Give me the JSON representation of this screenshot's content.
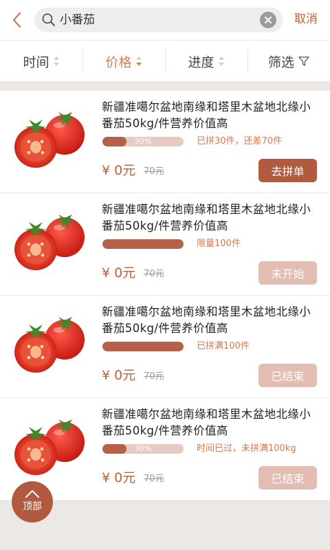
{
  "search": {
    "query": "小番茄",
    "cancel_label": "取消"
  },
  "filters": [
    {
      "label": "时间"
    },
    {
      "label": "价格"
    },
    {
      "label": "进度"
    },
    {
      "label": "筛选"
    }
  ],
  "colors": {
    "accent": "#b05a40",
    "accent_light": "#e3bcb2",
    "price": "#c0603a",
    "active_tab": "#d2824e"
  },
  "products": [
    {
      "title": "新疆准噶尔盆地南缘和塔里木盆地北缘小番茄50kg/件营养价值高",
      "progress_label": "30%",
      "progress": 0.3,
      "status": "已拼30件，还差70件",
      "price": "¥ 0元",
      "original_price": "70元",
      "action": "去拼单",
      "action_state": "active"
    },
    {
      "title": "新疆准噶尔盆地南缘和塔里木盆地北缘小番茄50kg/件营养价值高",
      "progress_label": "",
      "progress": 1.0,
      "status": "限量100件",
      "price": "¥ 0元",
      "original_price": "70元",
      "action": "未开始",
      "action_state": "disabled"
    },
    {
      "title": "新疆准噶尔盆地南缘和塔里木盆地北缘小番茄50kg/件营养价值高",
      "progress_label": "",
      "progress": 1.0,
      "status": "已拼满100件",
      "price": "¥ 0元",
      "original_price": "70元",
      "action": "已结束",
      "action_state": "disabled"
    },
    {
      "title": "新疆准噶尔盆地南缘和塔里木盆地北缘小番茄50kg/件营养价值高",
      "progress_label": "30%",
      "progress": 0.3,
      "status": "时间已过，未拼满100kg",
      "price": "¥ 0元",
      "original_price": "70元",
      "action": "已结束",
      "action_state": "disabled"
    }
  ],
  "back_to_top_label": "顶部"
}
